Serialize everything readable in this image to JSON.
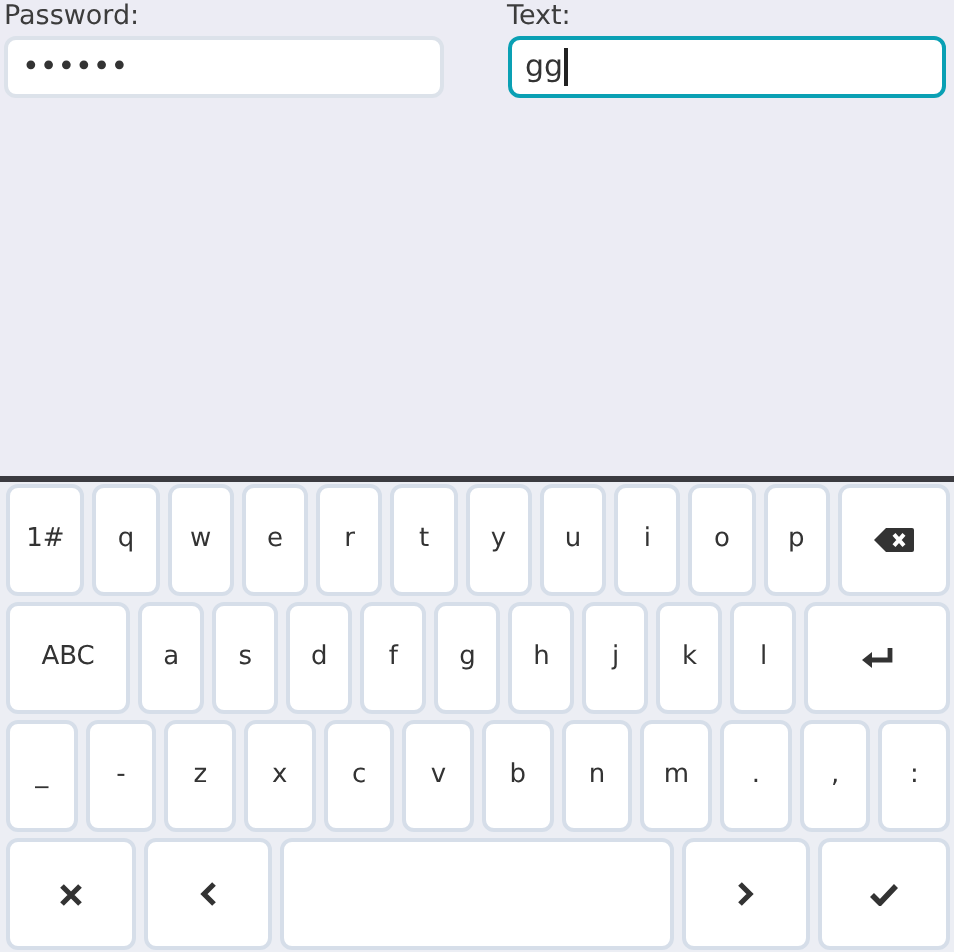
{
  "fields": [
    {
      "label": "Password:",
      "value": "••••••",
      "focused": false
    },
    {
      "label": "Text:",
      "value": "gg",
      "focused": true
    }
  ],
  "keyboard": {
    "rows": [
      [
        {
          "kind": "mode",
          "label": "1#"
        },
        {
          "kind": "char",
          "label": "q"
        },
        {
          "kind": "char",
          "label": "w"
        },
        {
          "kind": "char",
          "label": "e"
        },
        {
          "kind": "char",
          "label": "r"
        },
        {
          "kind": "char",
          "label": "t"
        },
        {
          "kind": "char",
          "label": "y"
        },
        {
          "kind": "char",
          "label": "u"
        },
        {
          "kind": "char",
          "label": "i"
        },
        {
          "kind": "char",
          "label": "o"
        },
        {
          "kind": "char",
          "label": "p"
        },
        {
          "kind": "backspace"
        }
      ],
      [
        {
          "kind": "mode",
          "label": "ABC"
        },
        {
          "kind": "char",
          "label": "a"
        },
        {
          "kind": "char",
          "label": "s"
        },
        {
          "kind": "char",
          "label": "d"
        },
        {
          "kind": "char",
          "label": "f"
        },
        {
          "kind": "char",
          "label": "g"
        },
        {
          "kind": "char",
          "label": "h"
        },
        {
          "kind": "char",
          "label": "j"
        },
        {
          "kind": "char",
          "label": "k"
        },
        {
          "kind": "char",
          "label": "l"
        },
        {
          "kind": "enter"
        }
      ],
      [
        {
          "kind": "char",
          "label": "_"
        },
        {
          "kind": "char",
          "label": "-"
        },
        {
          "kind": "char",
          "label": "z"
        },
        {
          "kind": "char",
          "label": "x"
        },
        {
          "kind": "char",
          "label": "c"
        },
        {
          "kind": "char",
          "label": "v"
        },
        {
          "kind": "char",
          "label": "b"
        },
        {
          "kind": "char",
          "label": "n"
        },
        {
          "kind": "char",
          "label": "m"
        },
        {
          "kind": "char",
          "label": "."
        },
        {
          "kind": "char",
          "label": ","
        },
        {
          "kind": "char",
          "label": ":"
        }
      ],
      [
        {
          "kind": "cancel"
        },
        {
          "kind": "left"
        },
        {
          "kind": "space"
        },
        {
          "kind": "right"
        },
        {
          "kind": "done"
        }
      ]
    ]
  }
}
